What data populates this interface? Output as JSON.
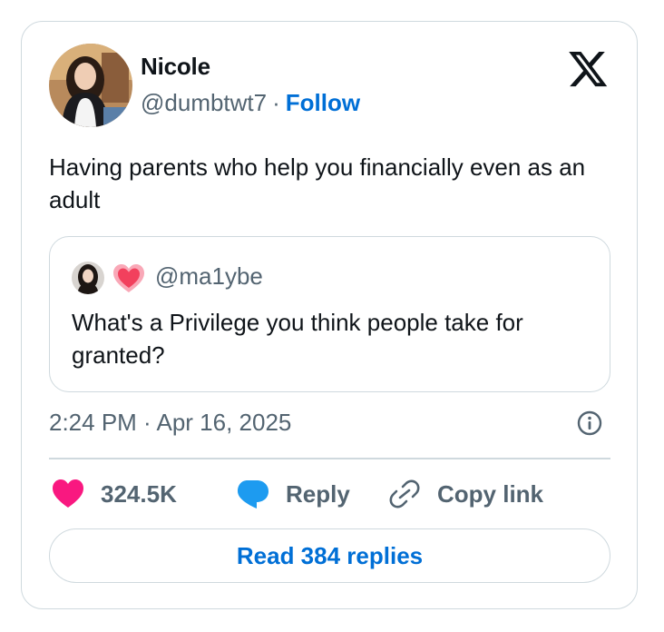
{
  "author": {
    "name": "Nicole",
    "handle": "@dumbtwt7",
    "separator": "·",
    "follow_label": "Follow"
  },
  "tweet": {
    "text": "Having parents who help you financially even as an adult",
    "timestamp": "2:24 PM · Apr 16, 2025"
  },
  "quoted_tweet": {
    "handle": "@ma1ybe",
    "emoji": "heart-emoji",
    "text": "What's a Privilege you think people take for granted?"
  },
  "actions": {
    "likes": "324.5K",
    "reply_label": "Reply",
    "copy_label": "Copy link"
  },
  "read_replies_label": "Read 384 replies",
  "icons": {
    "logo": "x-logo",
    "info": "info-icon",
    "like": "heart-icon",
    "reply": "speech-bubble-icon",
    "copy": "link-icon"
  },
  "colors": {
    "link_blue": "#006fd6",
    "like_pink": "#f91880",
    "reply_blue": "#1d9bf0",
    "secondary_text": "#536471",
    "border": "#cfd9de"
  }
}
